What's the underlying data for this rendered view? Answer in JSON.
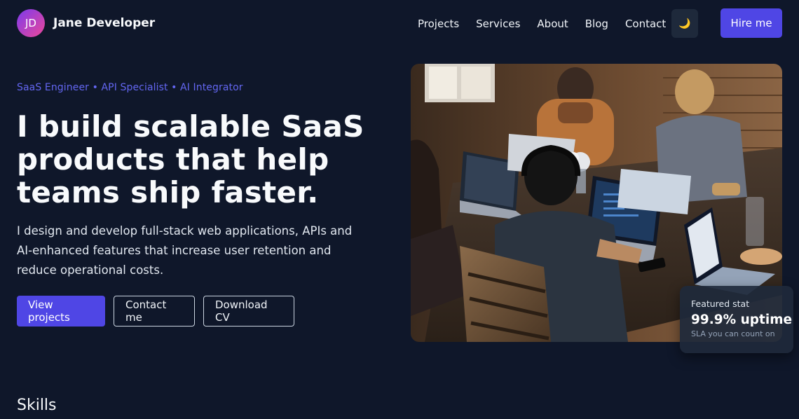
{
  "header": {
    "avatar_initials": "JD",
    "brand_name": "Jane Developer",
    "nav": [
      "Projects",
      "Services",
      "About",
      "Blog",
      "Contact"
    ],
    "theme_toggle_icon": "moon-icon",
    "theme_toggle_glyph": "🌙",
    "hire_label": "Hire me"
  },
  "hero": {
    "tagline": "SaaS Engineer • API Specialist • AI Integrator",
    "headline": "I build scalable SaaS products that help teams ship faster.",
    "lead": "I design and develop full-stack web applications, APIs and AI-enhanced features that increase user retention and reduce operational costs.",
    "buttons": {
      "primary": "View projects",
      "contact": "Contact me",
      "cv": "Download CV"
    }
  },
  "stat": {
    "label": "Featured stat",
    "value": "99.9% uptime",
    "sub": "SLA you can count on"
  },
  "sections": {
    "skills_title": "Skills"
  },
  "colors": {
    "background": "#0f172a",
    "accent": "#4f46e5",
    "tagline": "#6366f1",
    "card": "#1e293b"
  }
}
